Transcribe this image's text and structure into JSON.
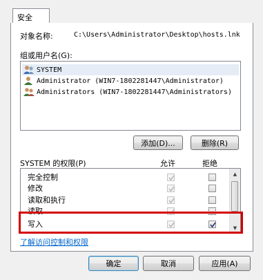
{
  "tab": {
    "label": "安全"
  },
  "object": {
    "label": "对象名称:",
    "value": "C:\\Users\\Administrator\\Desktop\\hosts.lnk"
  },
  "groups": {
    "label": "组或用户名(G):",
    "items": [
      {
        "name": "SYSTEM",
        "icon": "system-user-icon"
      },
      {
        "name": "Administrator (WIN7-1802281447\\Administrator)",
        "icon": "user-icon"
      },
      {
        "name": "Administrators (WIN7-1802281447\\Administrators)",
        "icon": "group-icon"
      }
    ]
  },
  "buttons": {
    "add": "添加(D)...",
    "remove": "删除(R)"
  },
  "permissions": {
    "title": "SYSTEM 的权限(P)",
    "allow_label": "允许",
    "deny_label": "拒绝",
    "rows": [
      {
        "name": "完全控制",
        "allow": true,
        "deny": false
      },
      {
        "name": "修改",
        "allow": true,
        "deny": false
      },
      {
        "name": "读取和执行",
        "allow": true,
        "deny": false
      },
      {
        "name": "读取",
        "allow": true,
        "deny": false
      },
      {
        "name": "写入",
        "allow": true,
        "deny": true
      }
    ]
  },
  "link": "了解访问控制和权限",
  "footer": {
    "ok": "确定",
    "cancel": "取消",
    "apply": "应用(A)"
  },
  "colors": {
    "highlight": "#d40000",
    "link": "#0066cc"
  }
}
